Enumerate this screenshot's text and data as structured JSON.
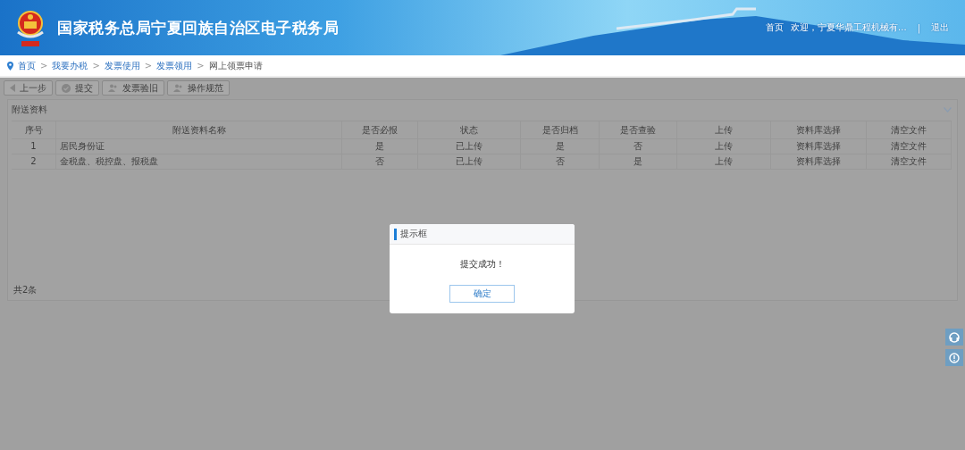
{
  "header": {
    "title": "国家税务总局宁夏回族自治区电子税务局",
    "nav": {
      "home": "首页",
      "welcome": "欢迎，宁夏华鼎工程机械有...",
      "separator": "|",
      "logout": "退出"
    }
  },
  "breadcrumb": [
    {
      "label": "首页"
    },
    {
      "separator": ">",
      "label": "我要办税"
    },
    {
      "separator": ">",
      "label": "发票使用"
    },
    {
      "separator": ">",
      "label": "发票领用"
    },
    {
      "separator": ">",
      "label": "网上领票申请"
    }
  ],
  "toolbar": [
    {
      "label": "上一步",
      "kind": "back"
    },
    {
      "label": "提交",
      "kind": "check"
    },
    {
      "label": "发票验旧",
      "kind": "people"
    },
    {
      "label": "操作规范",
      "kind": "people"
    }
  ],
  "panel": {
    "title": "附送资料",
    "footer": "共2条",
    "columns": [
      "序号",
      "附送资料名称",
      "是否必报",
      "状态",
      "是否归档",
      "是否查验",
      "上传",
      "资料库选择",
      "清空文件"
    ],
    "rows": [
      {
        "cells": [
          "1",
          "居民身份证",
          "是",
          "已上传",
          "是",
          "否",
          "上传",
          "资料库选择",
          "清空文件"
        ]
      },
      {
        "cells": [
          "2",
          "金税盘、税控盘、报税盘",
          "否",
          "已上传",
          "否",
          "是",
          "上传",
          "资料库选择",
          "清空文件"
        ]
      }
    ]
  },
  "dialog": {
    "title": "提示框",
    "message": "提交成功！",
    "button": "确定"
  }
}
